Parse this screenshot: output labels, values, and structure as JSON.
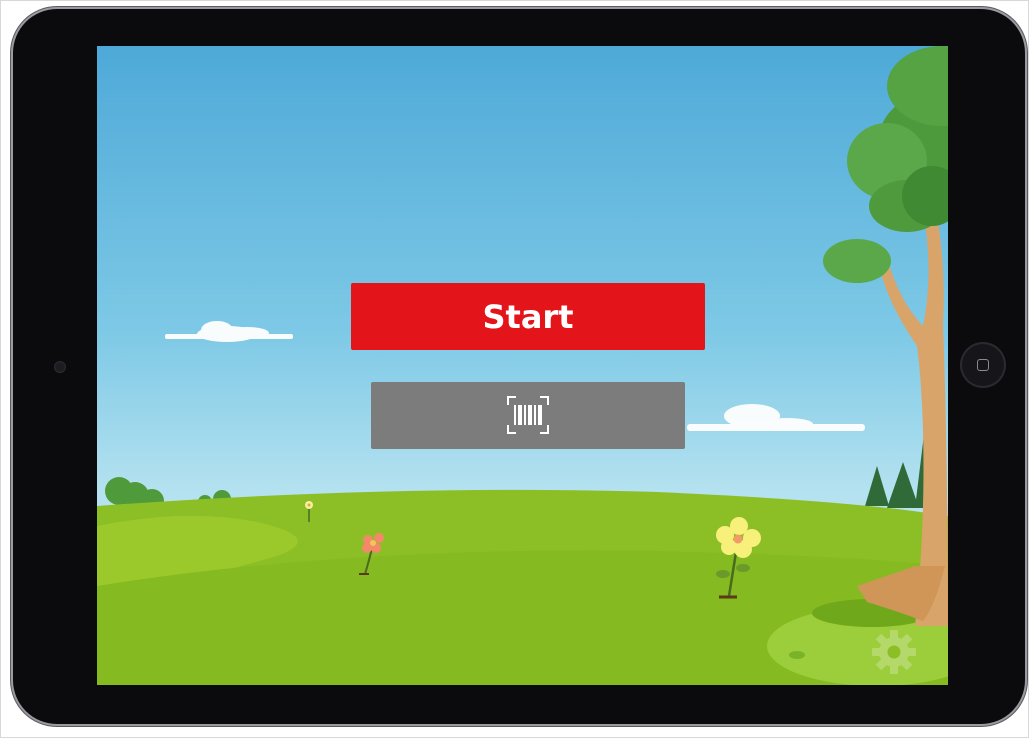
{
  "app": {
    "start_label": "Start"
  },
  "icons": {
    "scan": "barcode-scan-icon",
    "settings": "gear-icon",
    "home": "home-button-icon"
  },
  "colors": {
    "start_button": "#e3151b",
    "scan_button": "#7c7c7c",
    "sky": "#6cbfe2",
    "grass": "#8cbf26",
    "gear": "#b4d86a"
  }
}
